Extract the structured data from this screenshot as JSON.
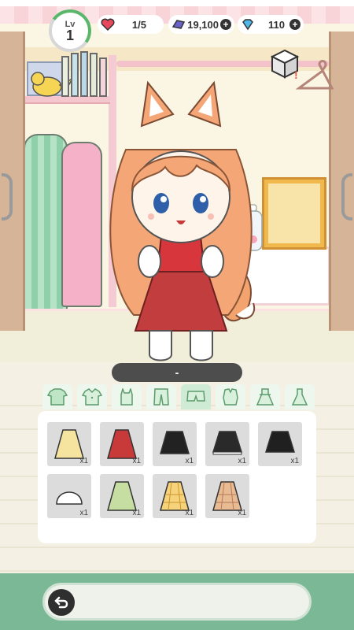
{
  "header": {
    "level_label": "Lv",
    "level_value": "1",
    "hearts": "1/5",
    "gems": "19,100",
    "diamonds": "110",
    "colors": {
      "heart": "#e8485c",
      "gem": "#6a63c9",
      "diamond": "#4fb8e8",
      "level_ring": "#5ab76a"
    }
  },
  "character": {
    "name": "-"
  },
  "categories": [
    {
      "icon": "tshirt-icon"
    },
    {
      "icon": "shirt-icon"
    },
    {
      "icon": "tanktop-icon"
    },
    {
      "icon": "pants-icon"
    },
    {
      "icon": "shorts-icon"
    },
    {
      "icon": "blouse-icon"
    },
    {
      "icon": "dress-icon"
    },
    {
      "icon": "gown-icon"
    }
  ],
  "items": [
    {
      "name": "yellow-skirt",
      "color": "#f5e3a0",
      "qty": "x1"
    },
    {
      "name": "red-skirt",
      "color": "#c83a3a",
      "qty": "x1"
    },
    {
      "name": "black-skirt",
      "color": "#222222",
      "qty": "x1"
    },
    {
      "name": "black-lace-skirt",
      "color": "#2a2a2a",
      "qty": "x1"
    },
    {
      "name": "black-pleated-skirt",
      "color": "#202020",
      "qty": "x1"
    },
    {
      "name": "white-skirt",
      "color": "#ffffff",
      "qty": "x1"
    },
    {
      "name": "green-skirt",
      "color": "#c6dea1",
      "qty": "x1"
    },
    {
      "name": "yellow-plaid-skirt",
      "color": "#f6d27a",
      "qty": "x1"
    },
    {
      "name": "tan-plaid-skirt",
      "color": "#e9bb92",
      "qty": "x1"
    }
  ],
  "footer": {
    "back_icon": "back-arrow-icon"
  }
}
